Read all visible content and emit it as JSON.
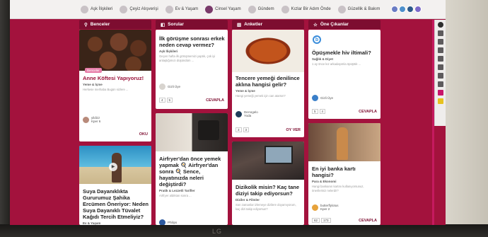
{
  "nav": {
    "items": [
      {
        "label": "Aşk İlişkileri",
        "icon": "heart-icon"
      },
      {
        "label": "Çeyiz Alışverişi",
        "icon": "gift-icon"
      },
      {
        "label": "Ev & Yaşam",
        "icon": "home-icon"
      },
      {
        "label": "Cinsel Yaşam",
        "icon": "couple-icon"
      },
      {
        "label": "Gündem",
        "icon": "news-icon"
      },
      {
        "label": "Kızlar Bir Adım Önde",
        "icon": "girls-icon"
      },
      {
        "label": "Güzellik & Bakım",
        "icon": "beauty-icon"
      }
    ]
  },
  "columns": [
    {
      "title": "Benceler",
      "icon": "pin-icon"
    },
    {
      "title": "Sorular",
      "icon": "question-icon"
    },
    {
      "title": "Anketler",
      "icon": "chart-icon"
    },
    {
      "title": "Öne Çıkanlar",
      "icon": "star-icon"
    }
  ],
  "cards": {
    "c1": {
      "badge": "Benceler",
      "title": "Anne Köftesi Yapıyoruz!",
      "cat": "Yeme & İçme",
      "body": "Herkese merhaba Bugün sizlere ...",
      "author": "yildizz",
      "author_sub": "Kper 6",
      "action": "OKU"
    },
    "c2": {
      "title": "Suya Dayanıklıkta Gururumuz Şahika Ercümen Öneriyor: Neden Suya Dayanıklı Tüvalet Kağıdı Tercih Etmeliyiz?",
      "cat": "Ev & Yaşam"
    },
    "q1": {
      "title": "İlk görüşme sonrası erkek neden cevap vermez?",
      "cat": "Aşk İlişkileri",
      "body": "Geçen hafta ilk görüşmemizi yaptık, çok iyi anlaştığımızı düşündüm ...",
      "author": "Gizli Üye",
      "counts": [
        "4",
        "5"
      ],
      "action": "CEVAPLA"
    },
    "q2": {
      "title": "Airfryer'dan önce yemek yapmak 🍳 Airfryer'dan sonra 🍳 Sence, hayatınızda neleri değiştirdi?",
      "cat": "Pratik & Lezzetli Tarifler",
      "body": "Airfryer aldıktan sonra ...",
      "author": "Philips"
    },
    "a1": {
      "title": "Tencere yemeği denilince aklına hangisi gelir?",
      "cat": "Yeme & İçme",
      "body": "Hangi yemeği yemek için can atarsın?",
      "author": "DeAngelo",
      "author_sub": "Yoda",
      "counts": [
        "3",
        "3"
      ],
      "action": "OY VER"
    },
    "a2": {
      "title": "Dizikolik misin? Kaç tane diziyi takip ediyorsun?",
      "cat": "Diziler & Filmler",
      "body": "Son zamanlar izlemeye dizilere doyamıyorum, kaç dizi takip ediyorsun?"
    },
    "f1": {
      "title": "Öpüşmekle hiv iltimali?",
      "cat": "Sağlık & Diyet",
      "body": "1 ay önce kız arkadaşımla öpüştük ...",
      "author": "Gizli Üye",
      "counts": [
        "5",
        "4"
      ],
      "action": "CEVAPLA"
    },
    "f2": {
      "title": "En iyi banka kartı hangisi?",
      "cat": "Para & Ekonomi",
      "body": "Hangi bankanın kartını kullanıyorsunuz, önerileriniz nelerdir?",
      "author": "butterflylotus",
      "author_sub": "Kper 2",
      "counts": [
        "62",
        "173"
      ],
      "action": "CEVAPLA"
    }
  },
  "brand": "LG"
}
